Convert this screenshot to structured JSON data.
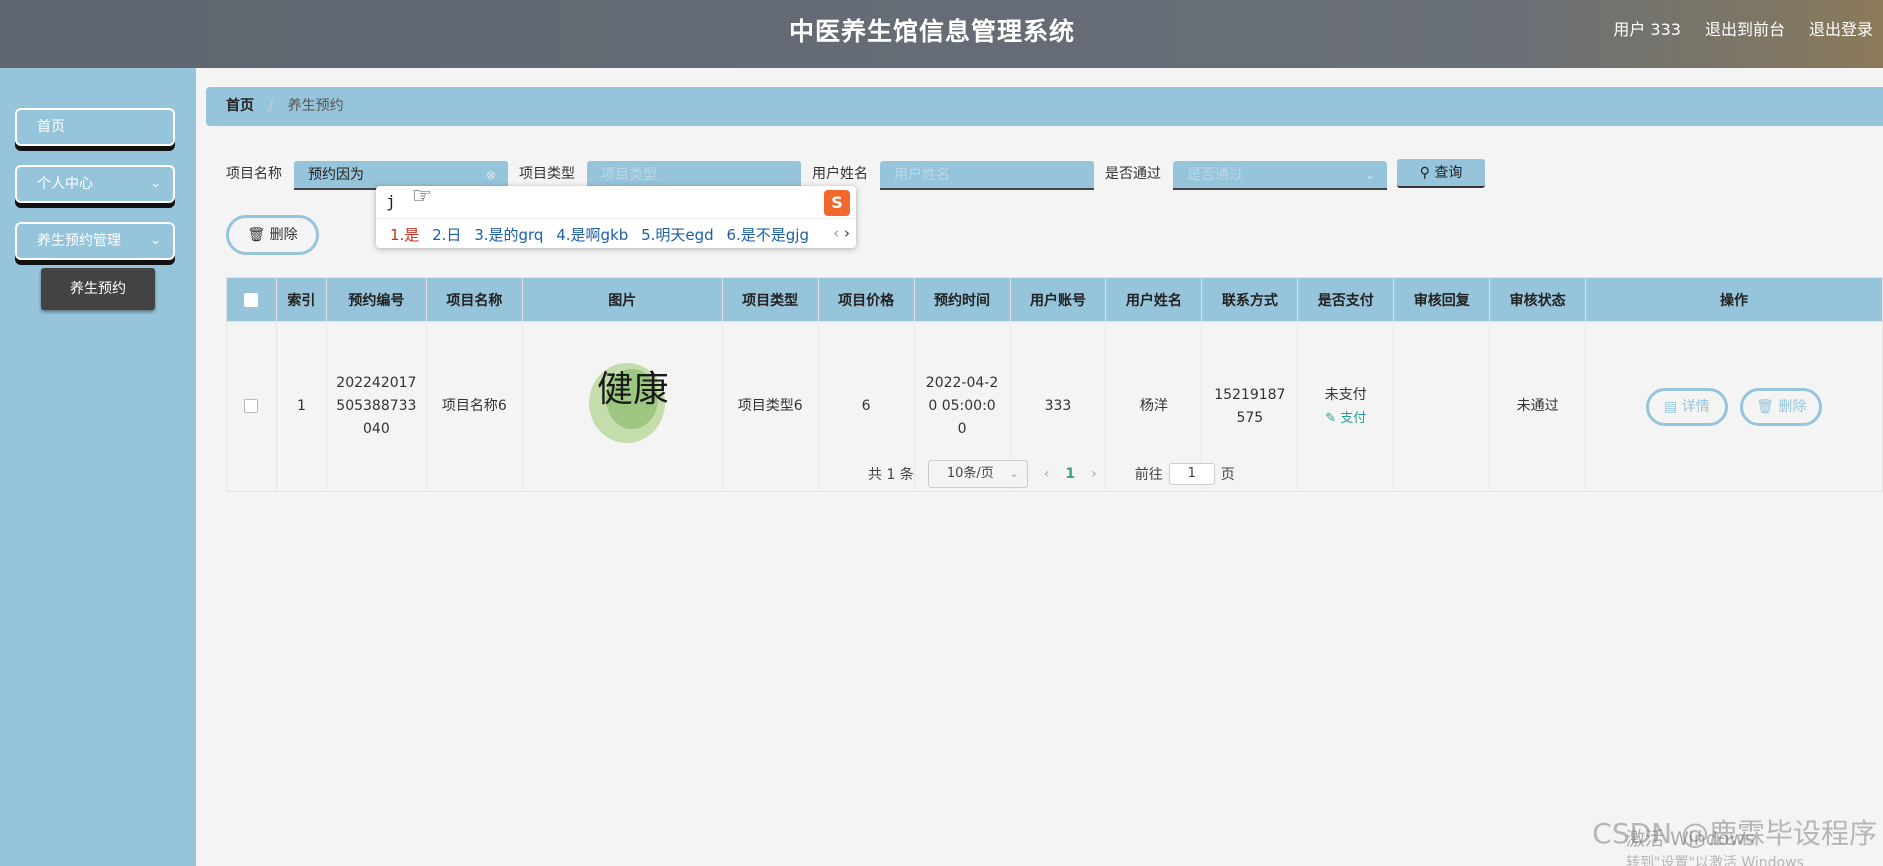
{
  "header": {
    "title": "中医养生馆信息管理系统",
    "user": "用户 333",
    "to_front": "退出到前台",
    "logout": "退出登录"
  },
  "sidebar": {
    "items": [
      {
        "label": "首页"
      },
      {
        "label": "个人中心"
      },
      {
        "label": "养生预约管理"
      }
    ],
    "subitem": "养生预约"
  },
  "breadcrumb": {
    "home": "首页",
    "sep": "/",
    "current": "养生预约"
  },
  "search": {
    "project_name_label": "项目名称",
    "project_name_value": "预约因为",
    "project_type_label": "项目类型",
    "project_type_placeholder": "项目类型",
    "user_name_label": "用户姓名",
    "user_name_placeholder": "用户姓名",
    "passed_label": "是否通过",
    "passed_placeholder": "是否通过",
    "query_label": "查询"
  },
  "toolbar": {
    "delete_label": "删除"
  },
  "ime": {
    "typed": "j",
    "candidates": [
      "1.是",
      "2.日",
      "3.是的grq",
      "4.是啊gkb",
      "5.明天egd",
      "6.是不是gjg"
    ],
    "nav_prev": "‹",
    "nav_next": "›"
  },
  "table": {
    "headers": [
      "索引",
      "预约编号",
      "项目名称",
      "图片",
      "项目类型",
      "项目价格",
      "预约时间",
      "用户账号",
      "用户姓名",
      "联系方式",
      "是否支付",
      "审核回复",
      "审核状态",
      "操作"
    ],
    "rows": [
      {
        "index": "1",
        "order_no": "202242017505388733040",
        "project_name": "项目名称6",
        "project_type": "项目类型6",
        "price": "6",
        "time": "2022-04-20 05:00:00",
        "account": "333",
        "user_name": "杨洋",
        "contact": "15219187575",
        "paid": "未支付",
        "pay_action": "支付",
        "reply": "",
        "status": "未通过",
        "detail_label": "详情",
        "delete_label": "删除",
        "image_text": "健康"
      }
    ]
  },
  "pager": {
    "total": "共 1 条",
    "page_size": "10条/页",
    "current_page": "1",
    "goto_label": "前往",
    "goto_value": "1",
    "page_suffix": "页"
  },
  "watermark": {
    "csdn": "CSDN @鹿霖毕设程序",
    "win1": "激活 Windows",
    "win2": "转到\"设置\"以激活 Windows"
  }
}
